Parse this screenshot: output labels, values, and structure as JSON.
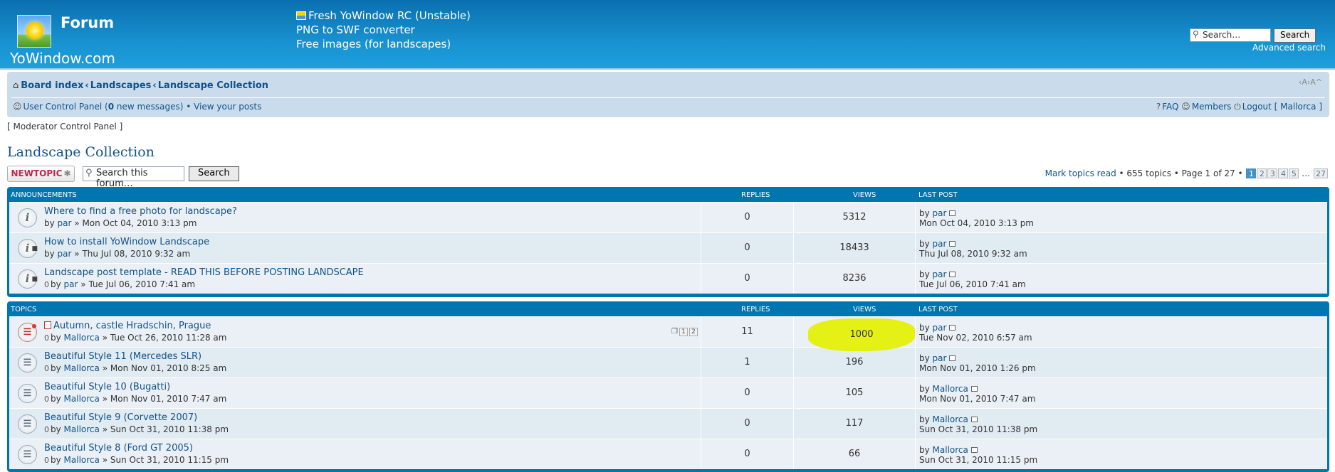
{
  "header": {
    "forum_label": "Forum",
    "site_name": "YoWindow.com",
    "promo_links": [
      "Fresh YoWindow RC (Unstable)",
      "PNG to SWF converter",
      "Free images (for landscapes)"
    ],
    "search_placeholder": "Search…",
    "search_button": "Search",
    "advanced_search": "Advanced search"
  },
  "nav": {
    "crumbs": [
      "Board index",
      "Landscapes",
      "Landscape Collection"
    ],
    "font_size": "‹A›A^",
    "ucp_label": "User Control Panel (",
    "new_messages_count": "0",
    "new_messages_label": " new messages)",
    "bullet": " • ",
    "view_posts": "View your posts",
    "faq": "FAQ",
    "members": "Members",
    "logout": "Logout [ Mallorca ]"
  },
  "modcp": "Moderator Control Panel",
  "page_title": "Landscape Collection",
  "actions": {
    "new_topic": "NEWTOPIC",
    "forum_search_placeholder": "Search this forum…",
    "forum_search_button": "Search"
  },
  "pagination": {
    "mark_read": "Mark topics read",
    "summary": " • 655 topics • Page 1 of 27 • ",
    "pages": [
      "1",
      "2",
      "3",
      "4",
      "5"
    ],
    "ellipsis": " … ",
    "last": "27"
  },
  "columns": {
    "replies": "REPLIES",
    "views": "VIEWS",
    "last_post": "LAST POST"
  },
  "announcements": {
    "heading": "ANNOUNCEMENTS",
    "rows": [
      {
        "title": "Where to find a free photo for landscape?",
        "author": "par",
        "date": "Mon Oct 04, 2010 3:13 pm",
        "replies": "0",
        "views": "5312",
        "lp_author": "par",
        "lp_date": "Mon Oct 04, 2010 3:13 pm"
      },
      {
        "title": "How to install YoWindow Landscape",
        "author": "par",
        "date": "Thu Jul 08, 2010 9:32 am",
        "replies": "0",
        "views": "18433",
        "lp_author": "par",
        "lp_date": "Thu Jul 08, 2010 9:32 am"
      },
      {
        "title": "Landscape post template - READ THIS BEFORE POSTING LANDSCAPE",
        "author": "par",
        "date": "Tue Jul 06, 2010 7:41 am",
        "replies": "0",
        "views": "8236",
        "lp_author": "par",
        "lp_date": "Tue Jul 06, 2010 7:41 am"
      }
    ]
  },
  "topics": {
    "heading": "TOPICS",
    "rows": [
      {
        "title": "Autumn, castle Hradschin, Prague",
        "author": "Mallorca",
        "date": "Tue Oct 26, 2010 11:28 am",
        "replies": "11",
        "views": "1000",
        "lp_author": "par",
        "lp_date": "Tue Nov 02, 2010 6:57 am",
        "pages": [
          "1",
          "2"
        ]
      },
      {
        "title": "Beautiful Style 11 (Mercedes SLR)",
        "author": "Mallorca",
        "date": "Mon Nov 01, 2010 8:25 am",
        "replies": "1",
        "views": "196",
        "lp_author": "par",
        "lp_date": "Mon Nov 01, 2010 1:26 pm"
      },
      {
        "title": "Beautiful Style 10 (Bugatti)",
        "author": "Mallorca",
        "date": "Mon Nov 01, 2010 7:47 am",
        "replies": "0",
        "views": "105",
        "lp_author": "Mallorca",
        "lp_date": "Mon Nov 01, 2010 7:47 am"
      },
      {
        "title": "Beautiful Style 9 (Corvette 2007)",
        "author": "Mallorca",
        "date": "Sun Oct 31, 2010 11:38 pm",
        "replies": "0",
        "views": "117",
        "lp_author": "Mallorca",
        "lp_date": "Sun Oct 31, 2010 11:38 pm"
      },
      {
        "title": "Beautiful Style 8 (Ford GT 2005)",
        "author": "Mallorca",
        "date": "Sun Oct 31, 2010 11:15 pm",
        "replies": "0",
        "views": "66",
        "lp_author": "Mallorca",
        "lp_date": "Sun Oct 31, 2010 11:15 pm"
      }
    ]
  },
  "common": {
    "by": "by ",
    "sep": " » "
  },
  "colors": {
    "header": "#1891cf",
    "link": "#105289",
    "table_frame": "#0076b1",
    "highlight": "#e4f000"
  }
}
